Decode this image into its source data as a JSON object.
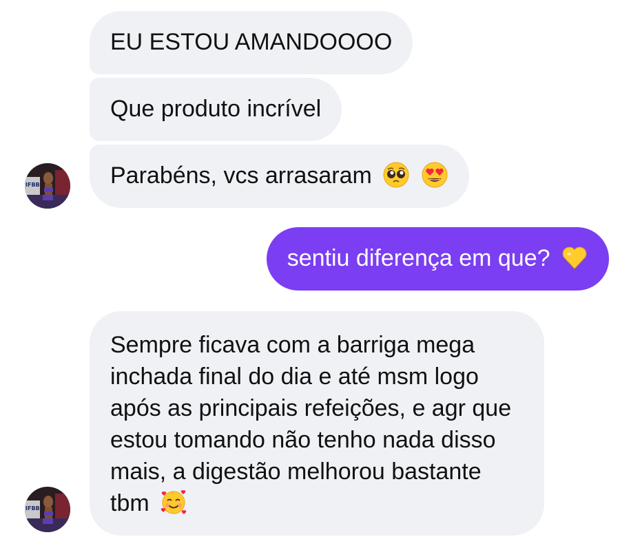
{
  "conversation": {
    "messages": [
      {
        "from": "them",
        "text": "EU ESTOU AMANDOOOO"
      },
      {
        "from": "them",
        "text": "Que produto incrível"
      },
      {
        "from": "them",
        "text": "Parabéns, vcs arrasaram",
        "emojis": [
          "pleading-face-icon",
          "heart-eyes-icon"
        ]
      },
      {
        "from": "me",
        "text": "sentiu diferença em que?",
        "emojis": [
          "yellow-heart-icon"
        ]
      },
      {
        "from": "them",
        "text": "Sempre ficava com a barriga mega inchada final do dia e até msm logo após as principais refeições, e agr que estou tomando não tenho nada disso mais, a digestão melhorou bastante tbm",
        "emojis": [
          "smiling-face-with-hearts-icon"
        ]
      }
    ]
  },
  "colors": {
    "incoming_bubble": "#eff1f5",
    "outgoing_bubble": "#7b3ef2",
    "outgoing_text": "#ffffff",
    "incoming_text": "#111111"
  }
}
